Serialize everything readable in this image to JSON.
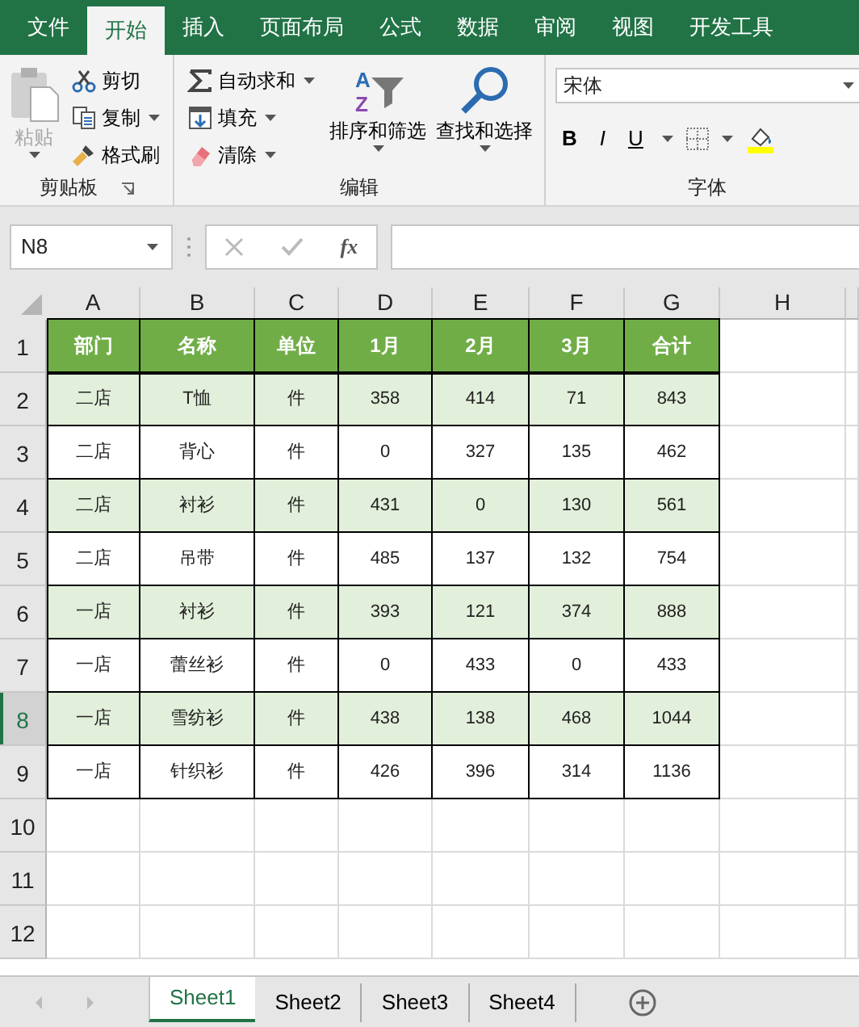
{
  "ribbon_tabs": [
    {
      "label": "文件",
      "selected": false
    },
    {
      "label": "开始",
      "selected": true
    },
    {
      "label": "插入",
      "selected": false
    },
    {
      "label": "页面布局",
      "selected": false
    },
    {
      "label": "公式",
      "selected": false
    },
    {
      "label": "数据",
      "selected": false
    },
    {
      "label": "审阅",
      "selected": false
    },
    {
      "label": "视图",
      "selected": false
    },
    {
      "label": "开发工具",
      "selected": false
    }
  ],
  "clipboard_group": {
    "paste": {
      "label": "粘贴",
      "disabled": true
    },
    "items": [
      {
        "label": "剪切",
        "kind": "cut",
        "dropdown": false
      },
      {
        "label": "复制",
        "kind": "copy",
        "dropdown": true
      },
      {
        "label": "格式刷",
        "kind": "brush",
        "dropdown": false
      }
    ],
    "label": "剪贴板"
  },
  "editing_group": {
    "items": [
      {
        "label": "自动求和",
        "kind": "sum",
        "dropdown": true
      },
      {
        "label": "填充",
        "kind": "fill",
        "dropdown": true
      },
      {
        "label": "清除",
        "kind": "eraser",
        "dropdown": true
      }
    ],
    "large_buttons": [
      {
        "label": "排序和筛选",
        "kind": "sort",
        "icon_letters": [
          "A",
          "Z"
        ]
      },
      {
        "label": "查找和选择",
        "kind": "find"
      }
    ],
    "label": "编辑"
  },
  "font_group": {
    "font_name": "宋体",
    "style_buttons": [
      {
        "label": "B",
        "kind": "bold"
      },
      {
        "label": "I",
        "kind": "italic"
      },
      {
        "label": "U",
        "kind": "underline"
      }
    ],
    "label": "字体"
  },
  "formula_bar": {
    "name_box": "N8",
    "function_label": "fx"
  },
  "columns": [
    "A",
    "B",
    "C",
    "D",
    "E",
    "F",
    "G",
    "H"
  ],
  "row_numbers": [
    {
      "label": "1",
      "active": false
    },
    {
      "label": "2",
      "active": false
    },
    {
      "label": "3",
      "active": false
    },
    {
      "label": "4",
      "active": false
    },
    {
      "label": "5",
      "active": false
    },
    {
      "label": "6",
      "active": false
    },
    {
      "label": "7",
      "active": false
    },
    {
      "label": "8",
      "active": true
    },
    {
      "label": "9",
      "active": false
    },
    {
      "label": "10",
      "active": false
    },
    {
      "label": "11",
      "active": false
    },
    {
      "label": "12",
      "active": false
    }
  ],
  "table": {
    "header": [
      "部门",
      "名称",
      "单位",
      "1月",
      "2月",
      "3月",
      "合计"
    ],
    "rows": [
      {
        "shaded": true,
        "cells": [
          "二店",
          "T恤",
          "件",
          "358",
          "414",
          "71",
          "843"
        ]
      },
      {
        "shaded": false,
        "cells": [
          "二店",
          "背心",
          "件",
          "0",
          "327",
          "135",
          "462"
        ]
      },
      {
        "shaded": true,
        "cells": [
          "二店",
          "衬衫",
          "件",
          "431",
          "0",
          "130",
          "561"
        ]
      },
      {
        "shaded": false,
        "cells": [
          "二店",
          "吊带",
          "件",
          "485",
          "137",
          "132",
          "754"
        ]
      },
      {
        "shaded": true,
        "cells": [
          "一店",
          "衬衫",
          "件",
          "393",
          "121",
          "374",
          "888"
        ]
      },
      {
        "shaded": false,
        "cells": [
          "一店",
          "蕾丝衫",
          "件",
          "0",
          "433",
          "0",
          "433"
        ]
      },
      {
        "shaded": true,
        "cells": [
          "一店",
          "雪纺衫",
          "件",
          "438",
          "138",
          "468",
          "1044"
        ]
      },
      {
        "shaded": false,
        "cells": [
          "一店",
          "针织衫",
          "件",
          "426",
          "396",
          "314",
          "1136"
        ]
      }
    ]
  },
  "sheet_tabs": [
    {
      "label": "Sheet1",
      "selected": true
    },
    {
      "label": "Sheet2",
      "selected": false
    },
    {
      "label": "Sheet3",
      "selected": false
    },
    {
      "label": "Sheet4",
      "selected": false
    }
  ]
}
